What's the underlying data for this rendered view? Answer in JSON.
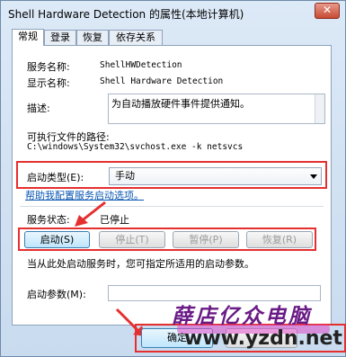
{
  "window": {
    "title": "Shell Hardware Detection 的属性(本地计算机)",
    "close_glyph": "✕"
  },
  "tabs": [
    {
      "label": "常规",
      "active": true
    },
    {
      "label": "登录",
      "active": false
    },
    {
      "label": "恢复",
      "active": false
    },
    {
      "label": "依存关系",
      "active": false
    }
  ],
  "general": {
    "service_name_label": "服务名称:",
    "service_name_value": "ShellHWDetection",
    "display_name_label": "显示名称:",
    "display_name_value": "Shell Hardware Detection",
    "description_label": "描述:",
    "description_value": "为自动播放硬件事件提供通知。",
    "exe_path_label": "可执行文件的路径:",
    "exe_path_value": "C:\\windows\\System32\\svchost.exe -k netsvcs",
    "startup_type_label": "启动类型(E):",
    "startup_type_value": "手动",
    "help_link": "帮助我配置服务启动选项。",
    "service_status_label": "服务状态:",
    "service_status_value": "已停止",
    "buttons": {
      "start": "启动(S)",
      "stop": "停止(T)",
      "pause": "暂停(P)",
      "resume": "恢复(R)"
    },
    "start_params_hint": "当从此处启动服务时，您可指定所适用的启动参数。",
    "start_params_label": "启动参数(M):",
    "start_params_value": ""
  },
  "footer": {
    "ok": "确定"
  },
  "watermark": {
    "brand": "薛店亿众电脑",
    "url": "www.yzdn.net"
  },
  "colors": {
    "highlight": "#e52f2f",
    "link": "#0a57b3"
  }
}
